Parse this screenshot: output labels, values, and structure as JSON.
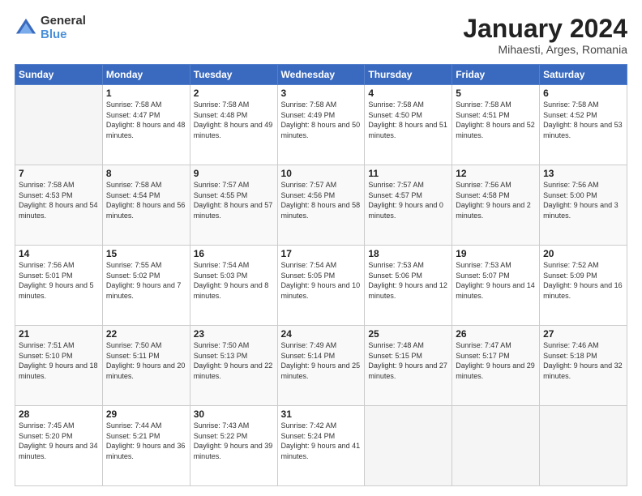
{
  "logo": {
    "general": "General",
    "blue": "Blue"
  },
  "title": "January 2024",
  "subtitle": "Mihaesti, Arges, Romania",
  "days_header": [
    "Sunday",
    "Monday",
    "Tuesday",
    "Wednesday",
    "Thursday",
    "Friday",
    "Saturday"
  ],
  "weeks": [
    [
      {
        "day": "",
        "sunrise": "",
        "sunset": "",
        "daylight": ""
      },
      {
        "day": "1",
        "sunrise": "Sunrise: 7:58 AM",
        "sunset": "Sunset: 4:47 PM",
        "daylight": "Daylight: 8 hours and 48 minutes."
      },
      {
        "day": "2",
        "sunrise": "Sunrise: 7:58 AM",
        "sunset": "Sunset: 4:48 PM",
        "daylight": "Daylight: 8 hours and 49 minutes."
      },
      {
        "day": "3",
        "sunrise": "Sunrise: 7:58 AM",
        "sunset": "Sunset: 4:49 PM",
        "daylight": "Daylight: 8 hours and 50 minutes."
      },
      {
        "day": "4",
        "sunrise": "Sunrise: 7:58 AM",
        "sunset": "Sunset: 4:50 PM",
        "daylight": "Daylight: 8 hours and 51 minutes."
      },
      {
        "day": "5",
        "sunrise": "Sunrise: 7:58 AM",
        "sunset": "Sunset: 4:51 PM",
        "daylight": "Daylight: 8 hours and 52 minutes."
      },
      {
        "day": "6",
        "sunrise": "Sunrise: 7:58 AM",
        "sunset": "Sunset: 4:52 PM",
        "daylight": "Daylight: 8 hours and 53 minutes."
      }
    ],
    [
      {
        "day": "7",
        "sunrise": "Sunrise: 7:58 AM",
        "sunset": "Sunset: 4:53 PM",
        "daylight": "Daylight: 8 hours and 54 minutes."
      },
      {
        "day": "8",
        "sunrise": "Sunrise: 7:58 AM",
        "sunset": "Sunset: 4:54 PM",
        "daylight": "Daylight: 8 hours and 56 minutes."
      },
      {
        "day": "9",
        "sunrise": "Sunrise: 7:57 AM",
        "sunset": "Sunset: 4:55 PM",
        "daylight": "Daylight: 8 hours and 57 minutes."
      },
      {
        "day": "10",
        "sunrise": "Sunrise: 7:57 AM",
        "sunset": "Sunset: 4:56 PM",
        "daylight": "Daylight: 8 hours and 58 minutes."
      },
      {
        "day": "11",
        "sunrise": "Sunrise: 7:57 AM",
        "sunset": "Sunset: 4:57 PM",
        "daylight": "Daylight: 9 hours and 0 minutes."
      },
      {
        "day": "12",
        "sunrise": "Sunrise: 7:56 AM",
        "sunset": "Sunset: 4:58 PM",
        "daylight": "Daylight: 9 hours and 2 minutes."
      },
      {
        "day": "13",
        "sunrise": "Sunrise: 7:56 AM",
        "sunset": "Sunset: 5:00 PM",
        "daylight": "Daylight: 9 hours and 3 minutes."
      }
    ],
    [
      {
        "day": "14",
        "sunrise": "Sunrise: 7:56 AM",
        "sunset": "Sunset: 5:01 PM",
        "daylight": "Daylight: 9 hours and 5 minutes."
      },
      {
        "day": "15",
        "sunrise": "Sunrise: 7:55 AM",
        "sunset": "Sunset: 5:02 PM",
        "daylight": "Daylight: 9 hours and 7 minutes."
      },
      {
        "day": "16",
        "sunrise": "Sunrise: 7:54 AM",
        "sunset": "Sunset: 5:03 PM",
        "daylight": "Daylight: 9 hours and 8 minutes."
      },
      {
        "day": "17",
        "sunrise": "Sunrise: 7:54 AM",
        "sunset": "Sunset: 5:05 PM",
        "daylight": "Daylight: 9 hours and 10 minutes."
      },
      {
        "day": "18",
        "sunrise": "Sunrise: 7:53 AM",
        "sunset": "Sunset: 5:06 PM",
        "daylight": "Daylight: 9 hours and 12 minutes."
      },
      {
        "day": "19",
        "sunrise": "Sunrise: 7:53 AM",
        "sunset": "Sunset: 5:07 PM",
        "daylight": "Daylight: 9 hours and 14 minutes."
      },
      {
        "day": "20",
        "sunrise": "Sunrise: 7:52 AM",
        "sunset": "Sunset: 5:09 PM",
        "daylight": "Daylight: 9 hours and 16 minutes."
      }
    ],
    [
      {
        "day": "21",
        "sunrise": "Sunrise: 7:51 AM",
        "sunset": "Sunset: 5:10 PM",
        "daylight": "Daylight: 9 hours and 18 minutes."
      },
      {
        "day": "22",
        "sunrise": "Sunrise: 7:50 AM",
        "sunset": "Sunset: 5:11 PM",
        "daylight": "Daylight: 9 hours and 20 minutes."
      },
      {
        "day": "23",
        "sunrise": "Sunrise: 7:50 AM",
        "sunset": "Sunset: 5:13 PM",
        "daylight": "Daylight: 9 hours and 22 minutes."
      },
      {
        "day": "24",
        "sunrise": "Sunrise: 7:49 AM",
        "sunset": "Sunset: 5:14 PM",
        "daylight": "Daylight: 9 hours and 25 minutes."
      },
      {
        "day": "25",
        "sunrise": "Sunrise: 7:48 AM",
        "sunset": "Sunset: 5:15 PM",
        "daylight": "Daylight: 9 hours and 27 minutes."
      },
      {
        "day": "26",
        "sunrise": "Sunrise: 7:47 AM",
        "sunset": "Sunset: 5:17 PM",
        "daylight": "Daylight: 9 hours and 29 minutes."
      },
      {
        "day": "27",
        "sunrise": "Sunrise: 7:46 AM",
        "sunset": "Sunset: 5:18 PM",
        "daylight": "Daylight: 9 hours and 32 minutes."
      }
    ],
    [
      {
        "day": "28",
        "sunrise": "Sunrise: 7:45 AM",
        "sunset": "Sunset: 5:20 PM",
        "daylight": "Daylight: 9 hours and 34 minutes."
      },
      {
        "day": "29",
        "sunrise": "Sunrise: 7:44 AM",
        "sunset": "Sunset: 5:21 PM",
        "daylight": "Daylight: 9 hours and 36 minutes."
      },
      {
        "day": "30",
        "sunrise": "Sunrise: 7:43 AM",
        "sunset": "Sunset: 5:22 PM",
        "daylight": "Daylight: 9 hours and 39 minutes."
      },
      {
        "day": "31",
        "sunrise": "Sunrise: 7:42 AM",
        "sunset": "Sunset: 5:24 PM",
        "daylight": "Daylight: 9 hours and 41 minutes."
      },
      {
        "day": "",
        "sunrise": "",
        "sunset": "",
        "daylight": ""
      },
      {
        "day": "",
        "sunrise": "",
        "sunset": "",
        "daylight": ""
      },
      {
        "day": "",
        "sunrise": "",
        "sunset": "",
        "daylight": ""
      }
    ]
  ]
}
